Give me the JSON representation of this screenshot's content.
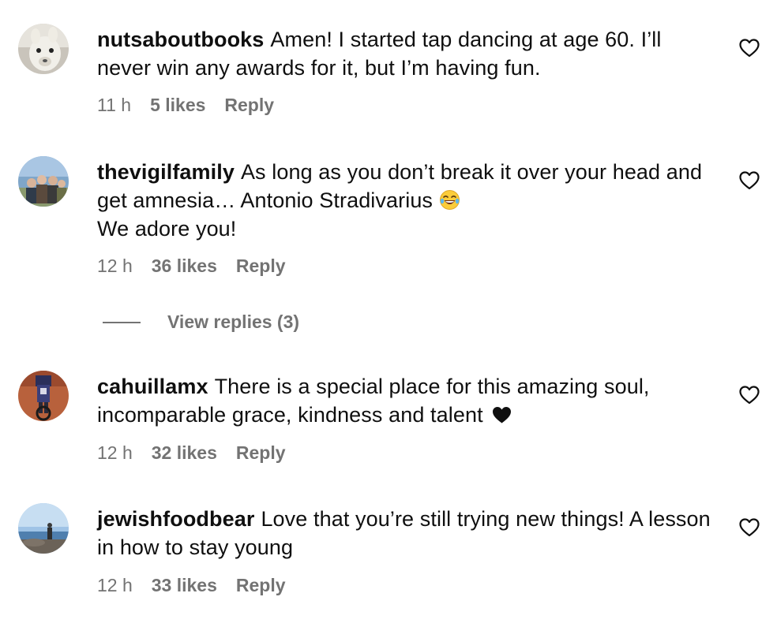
{
  "comments": [
    {
      "username": "nutsaboutbooks",
      "text": "Amen! I started tap dancing at age 60. I’ll never win any awards for it, but I’m having fun.",
      "time": "11 h",
      "likes": "5 likes",
      "reply_label": "Reply",
      "avatar_icon": "alpaca-avatar"
    },
    {
      "username": "thevigilfamily",
      "text_line1": "As long as you don’t break it over your head and get amnesia… Antonio Stradivarius",
      "text_line2": "We adore you!",
      "emoji": "face-with-tears-of-joy",
      "time": "12 h",
      "likes": "36 likes",
      "reply_label": "Reply",
      "avatar_icon": "family-photo-avatar"
    },
    {
      "username": "cahuillamx",
      "text": "There is a special place for this amazing soul, incomparable grace, kindness and talent",
      "emoji": "black-heart",
      "time": "12 h",
      "likes": "32 likes",
      "reply_label": "Reply",
      "avatar_icon": "motorcycle-avatar"
    },
    {
      "username": "jewishfoodbear",
      "text": "Love that you’re still trying new things! A lesson in how to stay young",
      "time": "12 h",
      "likes": "33 likes",
      "reply_label": "Reply",
      "avatar_icon": "seaside-avatar"
    }
  ],
  "view_replies": {
    "label": "View replies (3)"
  },
  "colors": {
    "text_primary": "#0f0f0f",
    "text_secondary": "#737373",
    "background": "#ffffff"
  }
}
